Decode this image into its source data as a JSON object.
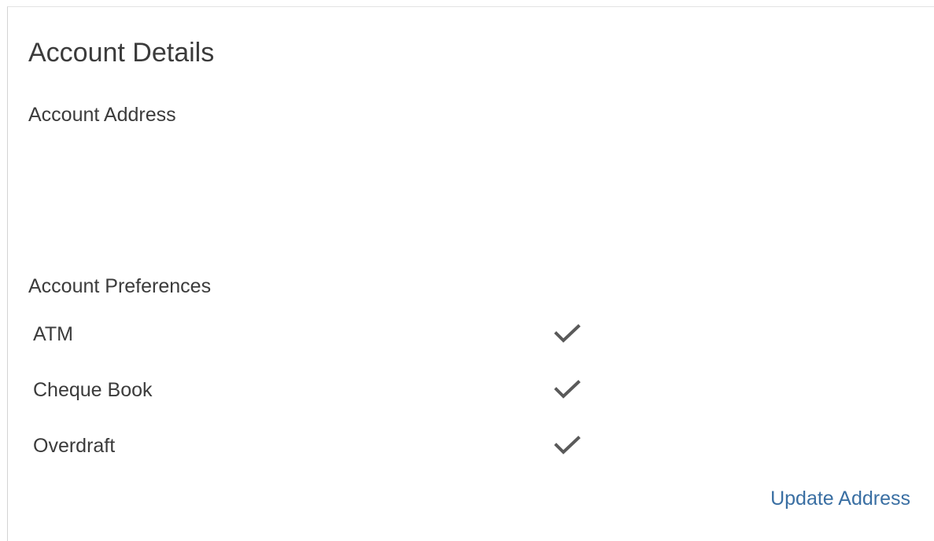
{
  "panel": {
    "title": "Account Details",
    "address": {
      "label": "Account Address"
    },
    "preferences": {
      "label": "Account Preferences",
      "items": [
        {
          "label": "ATM",
          "enabled": true,
          "icon": "checkmark-icon"
        },
        {
          "label": "Cheque Book",
          "enabled": true,
          "icon": "checkmark-icon"
        },
        {
          "label": "Overdraft",
          "enabled": true,
          "icon": "checkmark-icon"
        }
      ]
    },
    "actions": {
      "update_address_label": "Update Address"
    }
  },
  "colors": {
    "text": "#3b3b3b",
    "link": "#3a6fa3",
    "check": "#5a5a5a",
    "border": "#d4d4d4"
  }
}
